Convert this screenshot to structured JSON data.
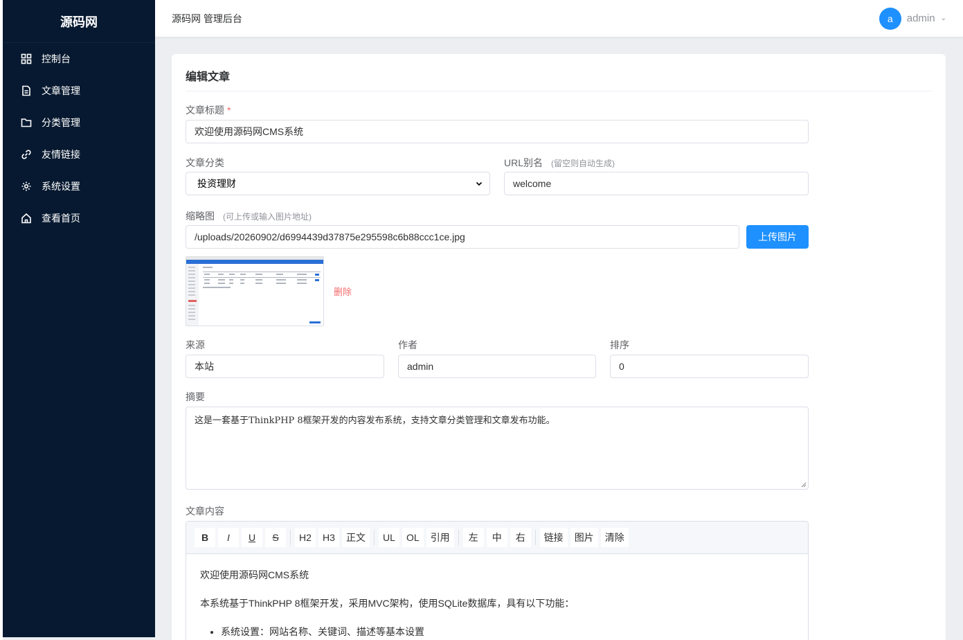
{
  "sidebar": {
    "logo": "源码网",
    "items": [
      {
        "label": "控制台",
        "icon": "dashboard-grid-icon"
      },
      {
        "label": "文章管理",
        "icon": "document-icon"
      },
      {
        "label": "分类管理",
        "icon": "folder-icon"
      },
      {
        "label": "友情链接",
        "icon": "link-icon"
      },
      {
        "label": "系统设置",
        "icon": "gear-icon"
      },
      {
        "label": "查看首页",
        "icon": "home-icon"
      }
    ]
  },
  "header": {
    "title": "源码网 管理后台",
    "avatar_letter": "a",
    "username": "admin"
  },
  "form": {
    "card_title": "编辑文章",
    "title_label": "文章标题",
    "required_mark": "*",
    "title_value": "欢迎使用源码网CMS系统",
    "category_label": "文章分类",
    "category_value": "投资理财",
    "slug_label": "URL别名",
    "slug_hint": "(留空则自动生成)",
    "slug_value": "welcome",
    "thumb_label": "缩略图",
    "thumb_hint": "(可上传或输入图片地址)",
    "thumb_value": "/uploads/20260902/d6994439d37875e295598c6b88ccc1ce.jpg",
    "upload_button": "上传图片",
    "delete_label": "删除",
    "source_label": "来源",
    "source_value": "本站",
    "author_label": "作者",
    "author_value": "admin",
    "sort_label": "排序",
    "sort_value": "0",
    "summary_label": "摘要",
    "summary_value": "这是一套基于ThinkPHP 8框架开发的内容发布系统，支持文章分类管理和文章发布功能。",
    "content_label": "文章内容"
  },
  "editor": {
    "toolbar_groups": [
      [
        "B",
        "I",
        "U",
        "S"
      ],
      [
        "H2",
        "H3",
        "正文"
      ],
      [
        "UL",
        "OL",
        "引用"
      ],
      [
        "左",
        "中",
        "右"
      ],
      [
        "链接",
        "图片",
        "清除"
      ]
    ],
    "para1": "欢迎使用源码网CMS系统",
    "para2": "本系统基于ThinkPHP 8框架开发，采用MVC架构，使用SQLite数据库，具有以下功能：",
    "bullet1": "系统设置：网站名称、关键词、描述等基本设置"
  },
  "colors": {
    "sidebar_bg": "#071930",
    "primary": "#1e90ff",
    "danger": "#f56c6c"
  }
}
